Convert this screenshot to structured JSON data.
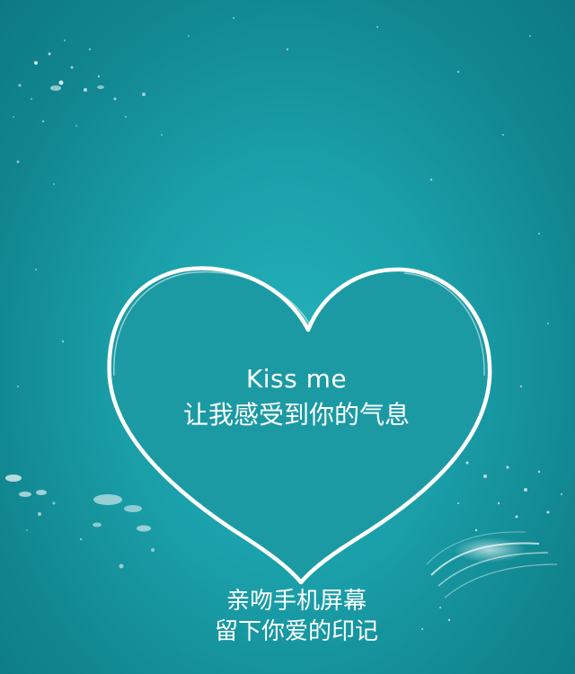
{
  "heart": {
    "line1": "Kiss me",
    "line2": "让我感受到你的气息"
  },
  "footer": {
    "line1": "亲吻手机屏幕",
    "line2": "留下你爱的印记"
  },
  "colors": {
    "background_center": "#25b3bb",
    "background_edge": "#0c7a84",
    "heart_fill": "#1b9aa4",
    "heart_outline": "#ffffff",
    "text": "#ffffff"
  },
  "icons": [
    "heart-icon",
    "water-splash-icon"
  ]
}
